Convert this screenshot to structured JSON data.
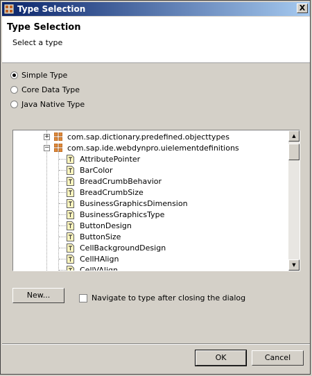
{
  "window": {
    "title": "Type Selection",
    "close_label": "X"
  },
  "header": {
    "title": "Type Selection",
    "subtitle": "Select a type"
  },
  "type_options": [
    {
      "label": "Simple Type",
      "checked": true
    },
    {
      "label": "Core Data Type",
      "checked": false
    },
    {
      "label": "Java Native Type",
      "checked": false
    }
  ],
  "tree": {
    "packages": [
      {
        "label": "com.sap.dictionary.predefined.objecttypes",
        "expanded": false
      },
      {
        "label": "com.sap.ide.webdynpro.uielementdefinitions",
        "expanded": true
      }
    ],
    "types": [
      "AttributePointer",
      "BarColor",
      "BreadCrumbBehavior",
      "BreadCrumbSize",
      "BusinessGraphicsDimension",
      "BusinessGraphicsType",
      "ButtonDesign",
      "ButtonSize",
      "CellBackgroundDesign",
      "CellHAlign",
      "CellVAlign"
    ],
    "expander_plus": "+",
    "expander_minus": "−",
    "scroll_up": "▲",
    "scroll_down": "▼"
  },
  "actions": {
    "new_label": "New...",
    "navigate_label": "Navigate to type after closing the dialog",
    "navigate_checked": false,
    "ok_label": "OK",
    "cancel_label": "Cancel"
  }
}
